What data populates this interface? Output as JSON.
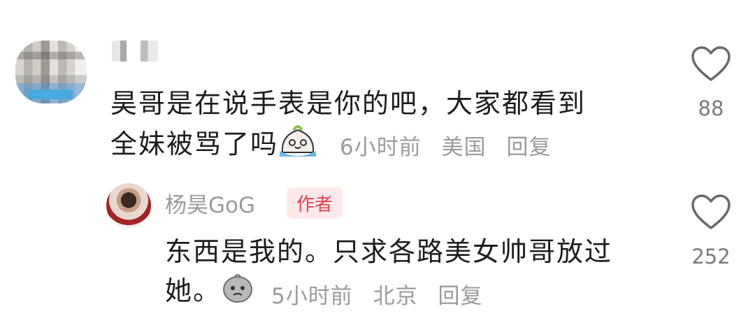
{
  "comment1": {
    "text_line1": "昊哥是在说手表是你的吧，大家都看到",
    "text_line2": "全妹被骂了吗",
    "time": "6小时前",
    "location": "美国",
    "reply_label": "回复",
    "likes": "88",
    "emoji": "crying-face-emoji"
  },
  "reply1": {
    "author": "杨昊GoG",
    "badge": "作者",
    "text_line1": "东西是我的。只求各路美女帅哥放过",
    "text_line2": "她。",
    "time": "5小时前",
    "location": "北京",
    "reply_label": "回复",
    "likes": "252",
    "emoji": "sad-face-emoji"
  }
}
